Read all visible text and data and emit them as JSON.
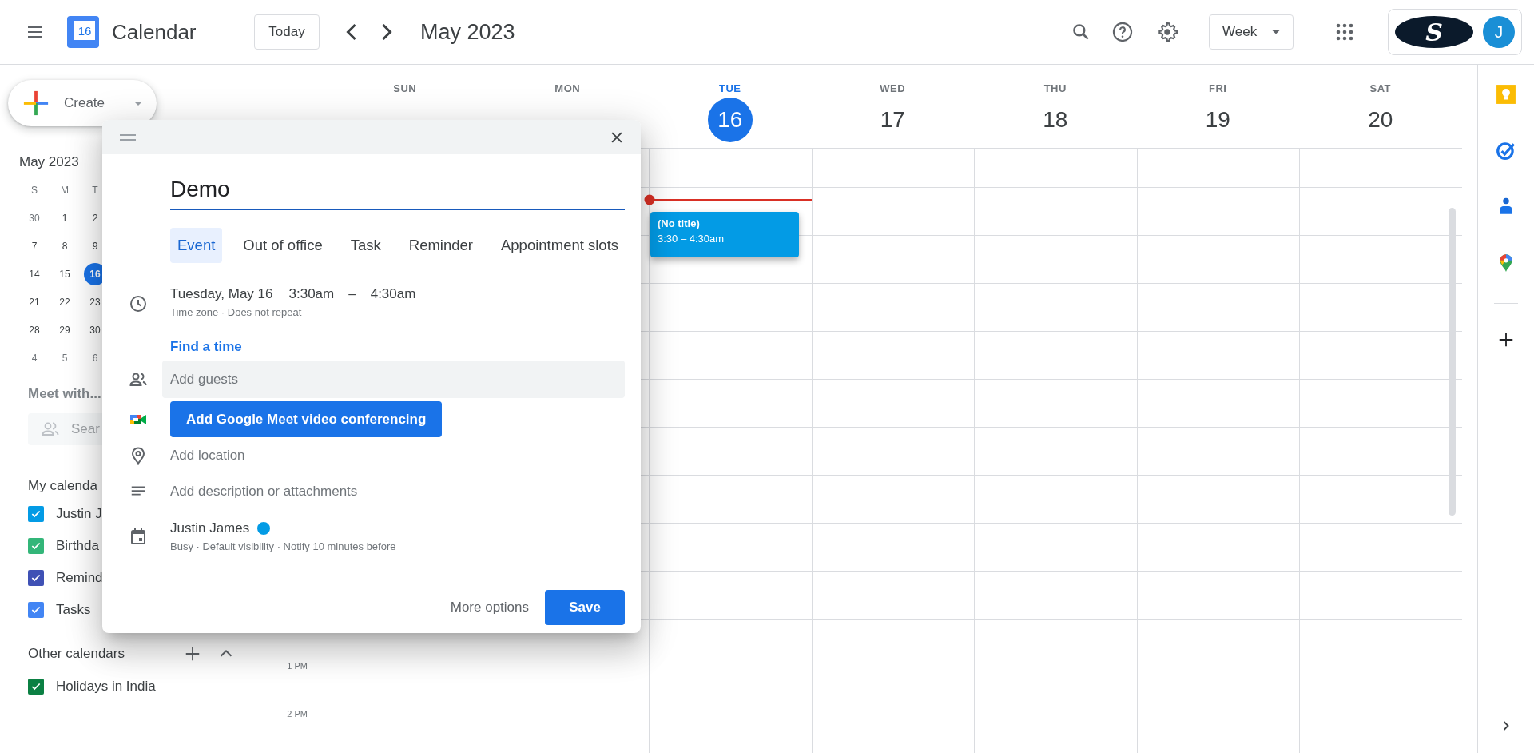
{
  "header": {
    "logo_day": "16",
    "app_name": "Calendar",
    "today_button": "Today",
    "period": "May 2023",
    "view": "Week",
    "account_logo": "S",
    "account_initial": "J"
  },
  "sidebar": {
    "create": "Create",
    "mini_calendar": {
      "title": "May 2023",
      "weekdays": [
        "S",
        "M",
        "T"
      ],
      "weeks": [
        [
          {
            "day": "30",
            "in_month": false,
            "selected": false
          },
          {
            "day": "1",
            "in_month": true,
            "selected": false
          },
          {
            "day": "2",
            "in_month": true,
            "selected": false
          }
        ],
        [
          {
            "day": "7",
            "in_month": true,
            "selected": false
          },
          {
            "day": "8",
            "in_month": true,
            "selected": false
          },
          {
            "day": "9",
            "in_month": true,
            "selected": false
          }
        ],
        [
          {
            "day": "14",
            "in_month": true,
            "selected": false
          },
          {
            "day": "15",
            "in_month": true,
            "selected": false
          },
          {
            "day": "16",
            "in_month": true,
            "selected": true
          }
        ],
        [
          {
            "day": "21",
            "in_month": true,
            "selected": false
          },
          {
            "day": "22",
            "in_month": true,
            "selected": false
          },
          {
            "day": "23",
            "in_month": true,
            "selected": false
          }
        ],
        [
          {
            "day": "28",
            "in_month": true,
            "selected": false
          },
          {
            "day": "29",
            "in_month": true,
            "selected": false
          },
          {
            "day": "30",
            "in_month": true,
            "selected": false
          }
        ],
        [
          {
            "day": "4",
            "in_month": false,
            "selected": false
          },
          {
            "day": "5",
            "in_month": false,
            "selected": false
          },
          {
            "day": "6",
            "in_month": false,
            "selected": false
          }
        ]
      ]
    },
    "meet_with": "Meet with...",
    "search_placeholder": "Sear",
    "my_calendars_title": "My calenda",
    "my_calendars": [
      {
        "label": "Justin J",
        "checked": true,
        "color": "#039be5"
      },
      {
        "label": "Birthda",
        "checked": true,
        "color": "#33b679"
      },
      {
        "label": "Remind",
        "checked": true,
        "color": "#3f51b5"
      },
      {
        "label": "Tasks",
        "checked": true,
        "color": "#4285f4"
      }
    ],
    "other_calendars_title": "Other calendars",
    "other_calendars": [
      {
        "label": "Holidays in India",
        "checked": true,
        "color": "#0b8043"
      }
    ]
  },
  "week": {
    "days": [
      {
        "weekday": "SUN",
        "today": false
      },
      {
        "weekday": "MON",
        "today": false
      },
      {
        "weekday": "TUE",
        "date": "16",
        "today": true,
        "now_line": true,
        "events": [
          {
            "title": "(No title)",
            "time": "3:30 – 4:30am"
          }
        ]
      },
      {
        "weekday": "WED",
        "date": "17",
        "today": false
      },
      {
        "weekday": "THU",
        "date": "18",
        "today": false
      },
      {
        "weekday": "FRI",
        "date": "19",
        "today": false
      },
      {
        "weekday": "SAT",
        "date": "20",
        "today": false
      }
    ],
    "time_labels": [
      "1 PM",
      "2 PM"
    ]
  },
  "event_dialog": {
    "title_value": "Demo",
    "types": [
      {
        "label": "Event",
        "selected": true
      },
      {
        "label": "Out of office",
        "selected": false
      },
      {
        "label": "Task",
        "selected": false
      },
      {
        "label": "Reminder",
        "selected": false
      },
      {
        "label": "Appointment slots",
        "selected": false
      }
    ],
    "date": "Tuesday, May 16",
    "start": "3:30am",
    "dash": "–",
    "end": "4:30am",
    "recurrence": "Time zone · Does not repeat",
    "find_time": "Find a time",
    "guests_placeholder": "Add guests",
    "meet_button": "Add Google Meet video conferencing",
    "location_placeholder": "Add location",
    "description_placeholder": "Add description or attachments",
    "calendar": {
      "name": "Justin James",
      "color": "#039be5"
    },
    "calendar_details": "Busy · Default visibility · Notify 10 minutes before",
    "more_options": "More options",
    "save": "Save"
  }
}
